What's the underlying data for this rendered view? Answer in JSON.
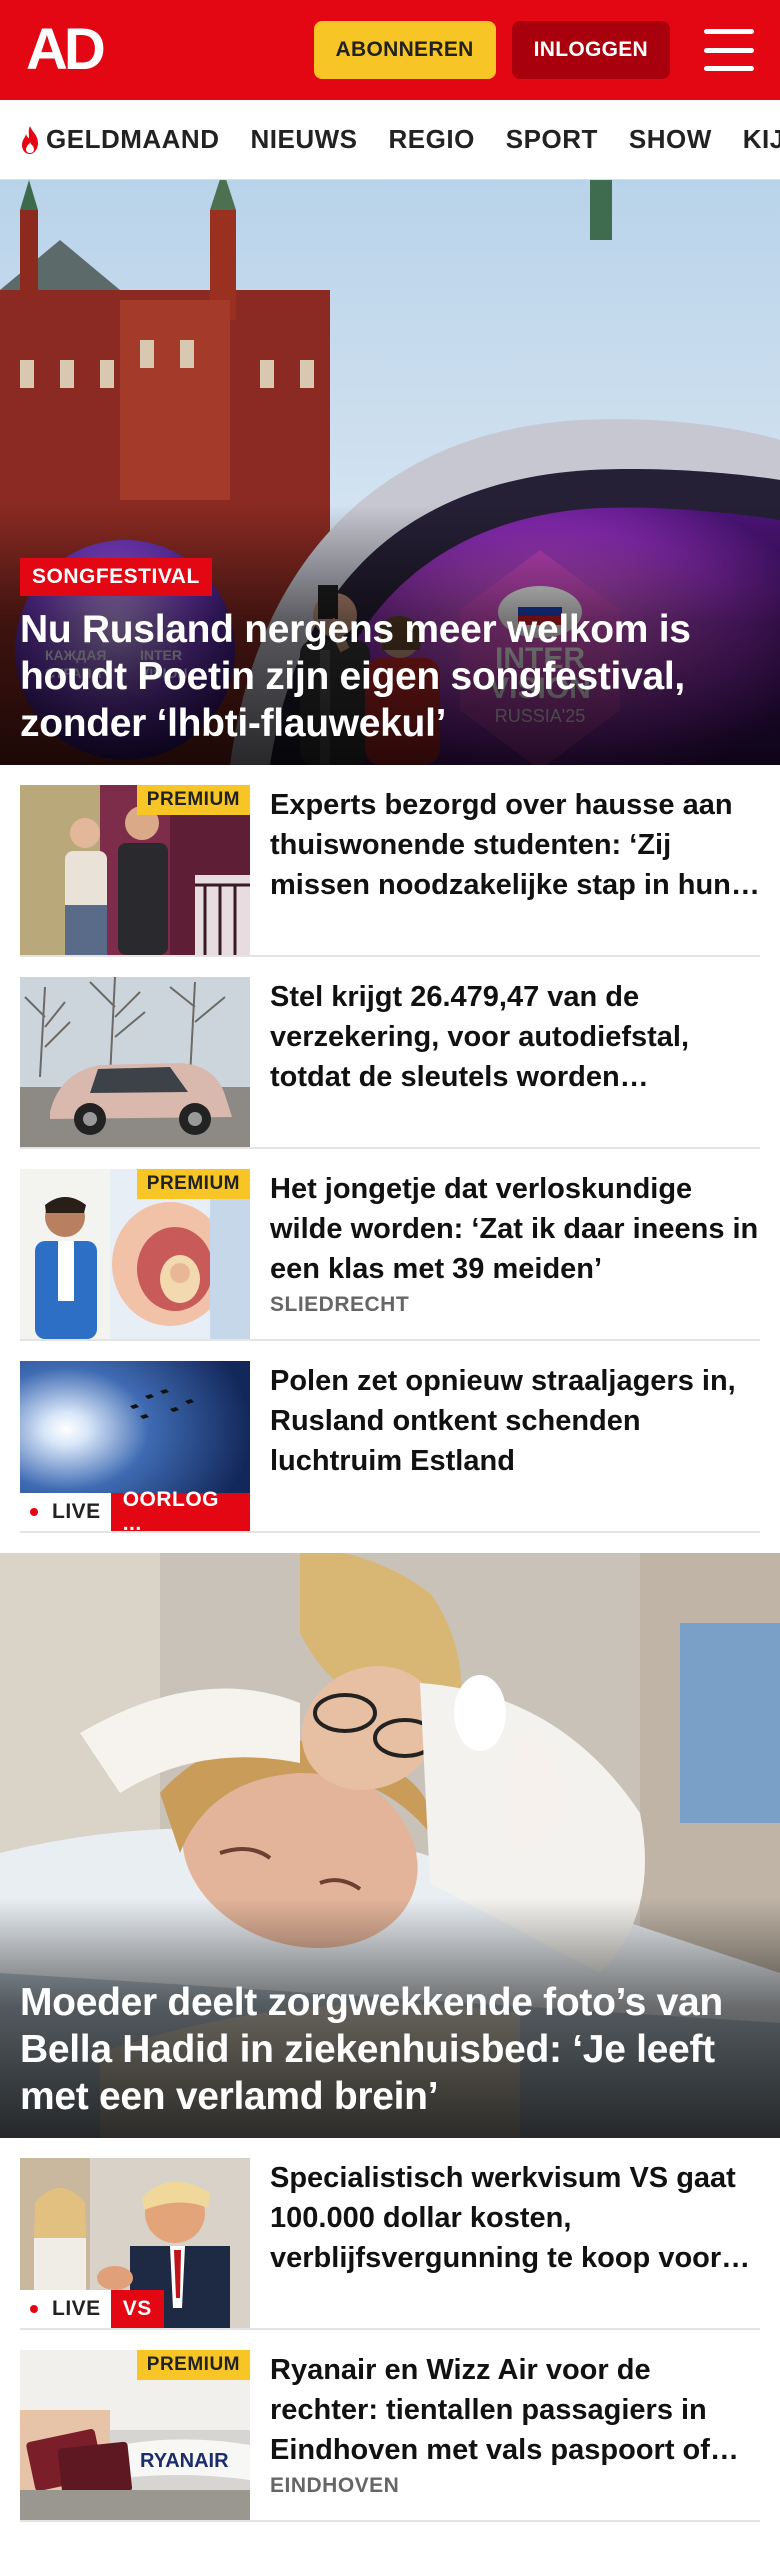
{
  "header": {
    "logo": "AD",
    "subscribe_label": "ABONNEREN",
    "login_label": "INLOGGEN",
    "colors": {
      "brand": "#e30613",
      "subscribe": "#f7c526",
      "login": "#a8000c"
    }
  },
  "nav": {
    "items": [
      {
        "label": "GELDMAAND",
        "icon": "flame-icon"
      },
      {
        "label": "NIEUWS"
      },
      {
        "label": "REGIO"
      },
      {
        "label": "SPORT"
      },
      {
        "label": "SHOW"
      },
      {
        "label": "KIJK"
      }
    ]
  },
  "hero": {
    "tag": "SONGFESTIVAL",
    "title": "Nu Rusland nergens meer welkom is houdt Poetin zijn eigen songfestival, zonder ‘lhbti-flauwekul’"
  },
  "articles_1": [
    {
      "title": "Experts bezorgd over hausse aan thuiswonende studenten: ‘Zij missen noodzakelijke stap in hun…",
      "premium": "PREMIUM"
    },
    {
      "title": "Stel krijgt 26.479,47 van de verzekering, voor autodiefstal, totdat de sleutels worden…"
    },
    {
      "title": "Het jongetje dat verloskundige wilde worden: ‘Zat ik daar ineens in een klas met 39 meiden’",
      "premium": "PREMIUM",
      "meta": "SLIEDRECHT"
    },
    {
      "title": "Polen zet opnieuw straaljagers in, Rusland ontkent schenden luchtruim Estland",
      "live": "LIVE",
      "live_category": "OORLOG ..."
    }
  ],
  "hero2": {
    "title": "Moeder deelt zorgwekkende foto’s van Bella Hadid in ziekenhuisbed: ‘Je leeft met een verlamd brein’"
  },
  "articles_2": [
    {
      "title": "Specialistisch werkvisum VS gaat 100.000 dollar kosten, verblijfsvergunning te koop voor…",
      "live": "LIVE",
      "live_category": "VS"
    },
    {
      "title": "Ryanair en Wizz Air voor de rechter: tientallen passagiers in Eindhoven met vals paspoort of…",
      "premium": "PREMIUM",
      "meta": "EINDHOVEN"
    }
  ]
}
